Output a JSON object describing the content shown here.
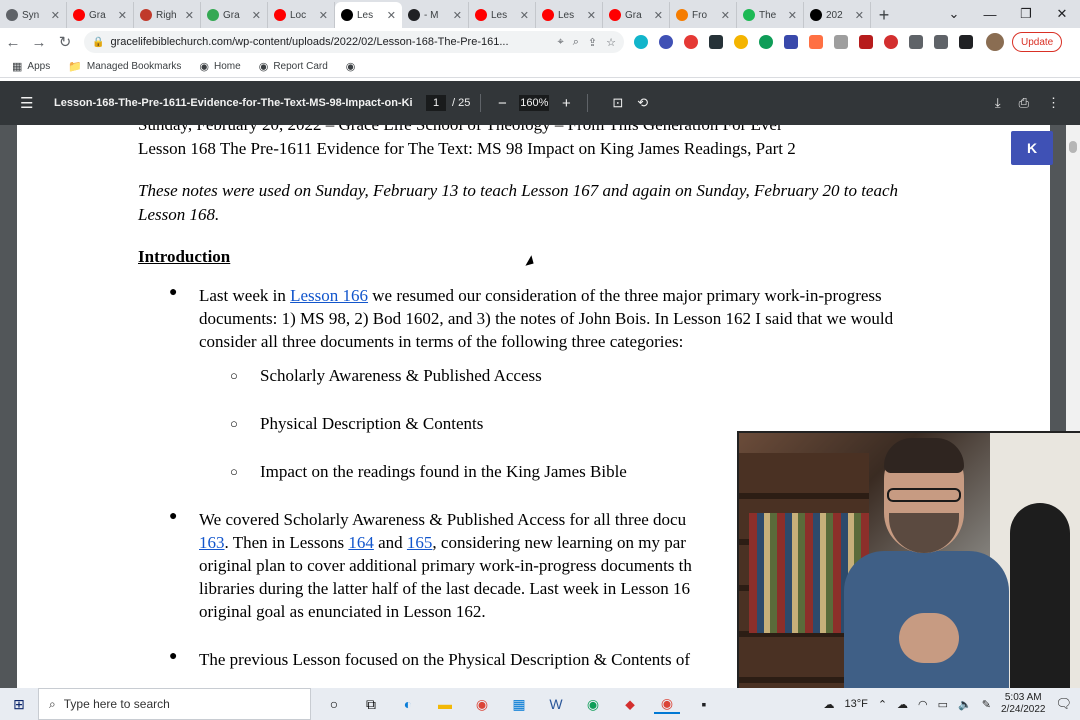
{
  "tabs": [
    {
      "title": "Syn",
      "color": "#5f6368",
      "active": false
    },
    {
      "title": "Gra",
      "color": "#ff0000",
      "active": false
    },
    {
      "title": "Righ",
      "color": "#c0392b",
      "active": false
    },
    {
      "title": "Gra",
      "color": "#34a853",
      "active": false
    },
    {
      "title": "Loc",
      "color": "#ff0000",
      "active": false
    },
    {
      "title": "Les",
      "color": "#000000",
      "active": true
    },
    {
      "title": "- M",
      "color": "#202124",
      "active": false
    },
    {
      "title": "Les",
      "color": "#ff0000",
      "active": false
    },
    {
      "title": "Les",
      "color": "#ff0000",
      "active": false
    },
    {
      "title": "Gra",
      "color": "#ff0000",
      "active": false
    },
    {
      "title": "Fro",
      "color": "#f57c00",
      "active": false
    },
    {
      "title": "The",
      "color": "#1db954",
      "active": false
    },
    {
      "title": "202",
      "color": "#000000",
      "active": false
    }
  ],
  "window_controls": {
    "minimize": "—",
    "maximize": "❐",
    "close": "✕",
    "chevron": "⌄"
  },
  "toolbar": {
    "back": "←",
    "forward": "→",
    "reload": "↻",
    "url": "gracelifebiblechurch.com/wp-content/uploads/2022/02/Lesson-168-The-Pre-161...",
    "update_label": "Update"
  },
  "bookmarks": [
    {
      "label": "Apps",
      "icon": "▦"
    },
    {
      "label": "Managed Bookmarks",
      "icon": "📁"
    },
    {
      "label": "Home",
      "icon": "◉"
    },
    {
      "label": "Report Card",
      "icon": "◉"
    },
    {
      "label": "",
      "icon": "◉"
    }
  ],
  "pdf": {
    "doc_title": "Lesson-168-The-Pre-1611-Evidence-for-The-Text-MS-98-Impact-on-Ki...",
    "page_current": "1",
    "page_total": "/ 25",
    "zoom": "160%",
    "zoom_out": "−",
    "zoom_in": "+"
  },
  "document": {
    "heading_line1": "Sunday, February 20, 2022 – Grace Life School of Theology – From This Generation For Ever",
    "heading_line2": "Lesson 168 The Pre-1611 Evidence for The Text: MS 98 Impact on King James Readings, Part 2",
    "notes": "These notes were used on Sunday, February 13 to teach Lesson 167 and again on Sunday, February 20 to teach Lesson 168.",
    "intro_heading": "Introduction",
    "bullet1_pre": "Last week in ",
    "bullet1_link": "Lesson 166",
    "bullet1_post": " we resumed our consideration of the three major primary work-in-progress documents: 1) MS 98, 2) Bod 1602, and 3) the notes of John Bois.  In Lesson 162 I said that we would consider all three documents in terms of the following three categories:",
    "sub1": "Scholarly Awareness & Published Access",
    "sub2": "Physical Description & Contents",
    "sub3": "Impact on the readings found in the King James Bible",
    "bullet2_pre": "We covered Scholarly Awareness & Published Access for all three docu",
    "bullet2_link1": "163",
    "bullet2_mid1": ".  Then in Lessons ",
    "bullet2_link2": "164",
    "bullet2_mid2": " and ",
    "bullet2_link3": "165",
    "bullet2_post": ", considering new learning on my par",
    "bullet2_line3": "original plan to cover additional primary work-in-progress documents th",
    "bullet2_line4": "libraries during the latter half of the last decade.  Last week in Lesson 16",
    "bullet2_line5": "original goal as enunciated in Lesson 162.",
    "bullet3": "The previous Lesson focused on the Physical Description & Contents of"
  },
  "overlay": {
    "k_button": "K"
  },
  "taskbar": {
    "search_placeholder": "Type here to search",
    "weather": "13°F",
    "time": "5:03 AM",
    "date": "2/24/2022"
  }
}
